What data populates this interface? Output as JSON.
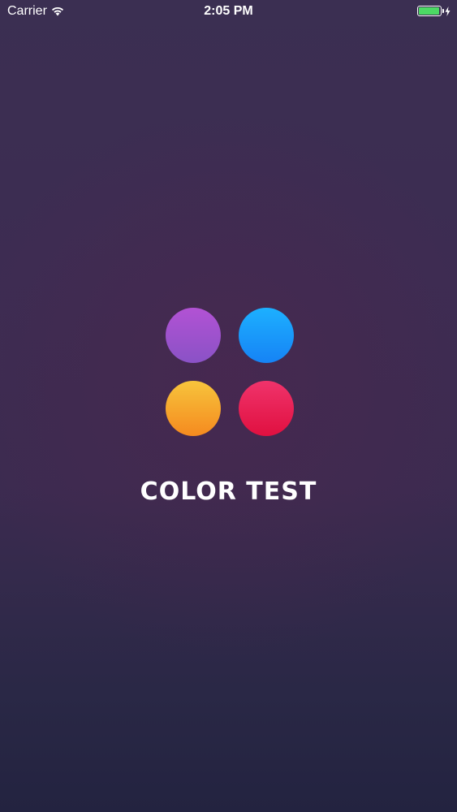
{
  "status_bar": {
    "carrier": "Carrier",
    "time": "2:05 PM",
    "wifi_icon": "wifi-icon",
    "battery_icon": "battery-icon",
    "charging_icon": "bolt-icon",
    "battery_level": 1.0,
    "battery_color": "#4cd964"
  },
  "splash": {
    "title": "COLOR TEST",
    "dots": [
      {
        "name": "purple",
        "top": "#b252d4",
        "bottom": "#8a52c6"
      },
      {
        "name": "blue",
        "top": "#1db0ff",
        "bottom": "#1683f5"
      },
      {
        "name": "orange",
        "top": "#f7c43c",
        "bottom": "#f58a1f"
      },
      {
        "name": "red",
        "top": "#f0336b",
        "bottom": "#e01040"
      }
    ]
  }
}
